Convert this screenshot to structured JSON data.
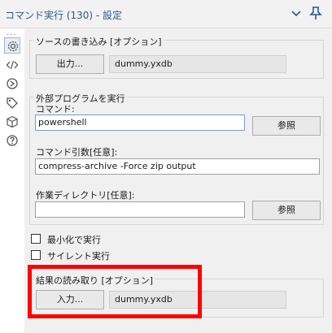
{
  "title": "コマンド実行 (130) - 設定",
  "sidebar": {
    "dots": "...",
    "icons": [
      "gear-icon",
      "code-icon",
      "connection-icon",
      "tag-icon",
      "cube-icon",
      "help-icon"
    ]
  },
  "source_output": {
    "title": "ソースの書き込み [オプション]",
    "button_label": "出力...",
    "filename": "dummy.yxdb"
  },
  "external_program": {
    "title": "外部プログラムを実行",
    "command_label": "コマンド:",
    "command_value": "powershell",
    "command_browse_label": "参照",
    "args_label": "コマンド引数[任意]:",
    "args_value": "compress-archive -Force zip output",
    "workdir_label": "作業ディレクトリ[任意]:",
    "workdir_value": "",
    "workdir_browse_label": "参照"
  },
  "options": {
    "minimize_label": "最小化で実行",
    "minimize_checked": false,
    "silent_label": "サイレント実行",
    "silent_checked": false
  },
  "read_results": {
    "title": "結果の読み取り [オプション]",
    "button_label": "入力...",
    "filename": "dummy.yxdb"
  },
  "colors": {
    "title_text": "#2b5797",
    "highlight": "#ff0000",
    "panel_bg": "#f0f0f0"
  }
}
